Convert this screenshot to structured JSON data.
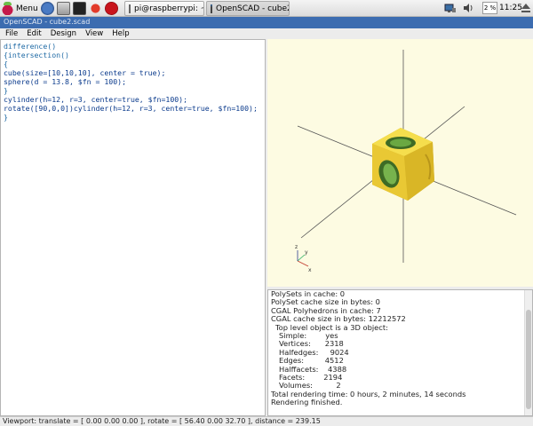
{
  "taskbar": {
    "menu_label": "Menu",
    "tasks": [
      {
        "label": "pi@raspberrypi: ~",
        "icon": "terminal-icon"
      },
      {
        "label": "OpenSCAD - cube2.s...",
        "icon": "openscad-window-icon"
      }
    ],
    "cpu_label": "2 %",
    "clock": "11:25"
  },
  "window": {
    "title": "OpenSCAD - cube2.scad"
  },
  "menubar": {
    "items": [
      {
        "label": "File"
      },
      {
        "label": "Edit"
      },
      {
        "label": "Design"
      },
      {
        "label": "View"
      },
      {
        "label": "Help"
      }
    ]
  },
  "editor": {
    "lines": [
      "difference()",
      "{intersection()",
      "{",
      "cube(size=[10,10,10], center = true);",
      "sphere(d = 13.8, $fn = 100);",
      "}",
      "cylinder(h=12, r=3, center=true, $fn=100);",
      "rotate([90,0,0])cylinder(h=12, r=3, center=true, $fn=100);",
      "}"
    ]
  },
  "viewport": {
    "axis_labels": {
      "x": "x",
      "y": "y",
      "z": "z"
    },
    "colors": {
      "background": "#fdfbe2",
      "object": "#f2d23a",
      "hole": "#5f9c3a"
    }
  },
  "console": {
    "lines": [
      {
        "text": "PolySets in cache: 0",
        "indent": 0
      },
      {
        "text": "PolySet cache size in bytes: 0",
        "indent": 0
      },
      {
        "text": "CGAL Polyhedrons in cache: 7",
        "indent": 0
      },
      {
        "text": "CGAL cache size in bytes: 12212572",
        "indent": 0
      },
      {
        "text": "Top level object is a 3D object:",
        "indent": 1
      },
      {
        "text": "Simple:        yes",
        "indent": 2
      },
      {
        "text": "Vertices:      2318",
        "indent": 2
      },
      {
        "text": "Halfedges:     9024",
        "indent": 2
      },
      {
        "text": "Edges:         4512",
        "indent": 2
      },
      {
        "text": "Halffacets:    4388",
        "indent": 2
      },
      {
        "text": "Facets:        2194",
        "indent": 2
      },
      {
        "text": "Volumes:          2",
        "indent": 2
      },
      {
        "text": "Total rendering time: 0 hours, 2 minutes, 14 seconds",
        "indent": 0
      },
      {
        "text": "Rendering finished.",
        "indent": 0
      }
    ]
  },
  "statusbar": {
    "text": "Viewport: translate = [ 0.00 0.00 0.00 ], rotate = [ 56.40 0.00 32.70 ], distance = 239.15"
  }
}
